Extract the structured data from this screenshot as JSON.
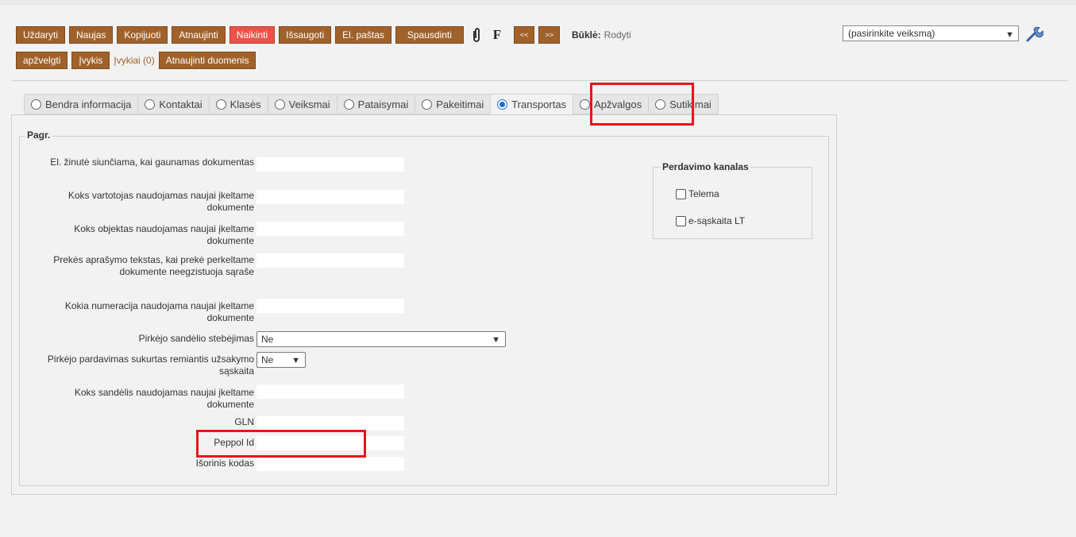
{
  "toolbar": {
    "row1": [
      "Uždaryti",
      "Naujas",
      "Kopijuoti",
      "Atnaujinti",
      "Naikinti",
      "Išsaugoti",
      "El. paštas",
      "Spausdinti"
    ],
    "prev_label": "<<",
    "next_label": ">>",
    "f_label": "F",
    "state_label": "Būklė:",
    "state_value": "Rodyti",
    "action_select": "(pasirinkite veiksmą)",
    "row2": {
      "apzvelgti": "apžvelgti",
      "ivykis": "Įvykis",
      "ivykiai": "Įvykiai (0)",
      "atnaujinti_duomenis": "Atnaujinti duomenis"
    }
  },
  "tabs": [
    "Bendra informacija",
    "Kontaktai",
    "Klasės",
    "Veiksmai",
    "Pataisymai",
    "Pakeitimai",
    "Transportas",
    "Apžvalgos",
    "Sutikimai"
  ],
  "active_tab": "Transportas",
  "section": {
    "legend": "Pagr.",
    "fields": {
      "f1": "El. žinutė siunčiama, kai gaunamas dokumentas",
      "f2": "Koks vartotojas naudojamas naujai įkeltame dokumente",
      "f3": "Koks objektas naudojamas naujai įkeltame dokumente",
      "f4": "Prekės aprašymo tekstas, kai prekė perkeltame dokumente neegzistuoja sąraše",
      "f5": "Kokia numeracija naudojama naujai įkeltame dokumente",
      "f6": "Pirkėjo sandėlio stebėjimas",
      "f6_value": "Ne",
      "f7": "Pirkėjo pardavimas sukurtas remiantis užsakymo sąskaita",
      "f7_value": "Ne",
      "f8": "Koks sandėlis naudojamas naujai įkeltame dokumente",
      "f9": "GLN",
      "f10": "Peppol Id",
      "f11": "Išorinis kodas"
    }
  },
  "channel": {
    "legend": "Perdavimo kanalas",
    "telema": "Telema",
    "esaskaita": "e-sąskaita LT"
  },
  "colors": {
    "button": "#a0622a",
    "danger": "#e8544a",
    "highlight": "#e8141c",
    "radio_on": "#1a6fd6"
  }
}
